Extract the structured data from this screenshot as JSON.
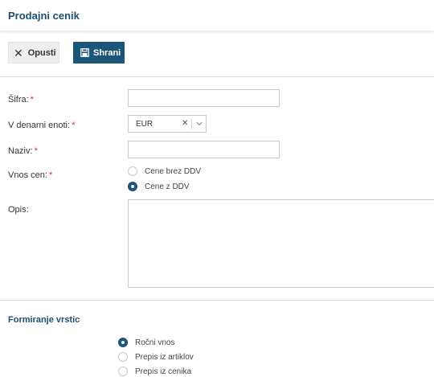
{
  "header": {
    "title": "Prodajni cenik"
  },
  "toolbar": {
    "cancel_label": "Opusti",
    "save_label": "Shrani"
  },
  "form": {
    "code_label": "Šifra:",
    "currency_label": "V denarni enoti:",
    "currency_value": "EUR",
    "name_label": "Naziv:",
    "price_entry_label": "Vnos cen:",
    "price_entry_options": [
      {
        "label": "Cene brez DDV",
        "selected": false
      },
      {
        "label": "Cene z DDV",
        "selected": true
      }
    ],
    "description_label": "Opis:",
    "required_mark": "*"
  },
  "rows_section": {
    "title": "Formiranje vrstic",
    "options": [
      {
        "label": "Ročni vnos",
        "selected": true
      },
      {
        "label": "Prepis iz artiklov",
        "selected": false
      },
      {
        "label": "Prepis iz cenika",
        "selected": false
      }
    ]
  },
  "colors": {
    "primary": "#1b5577",
    "title": "#1b4f72",
    "required": "#d0312d"
  },
  "icons": {
    "cancel": "close-icon",
    "save": "save-icon",
    "clear": "clear-icon",
    "dropdown": "chevron-down-icon"
  }
}
